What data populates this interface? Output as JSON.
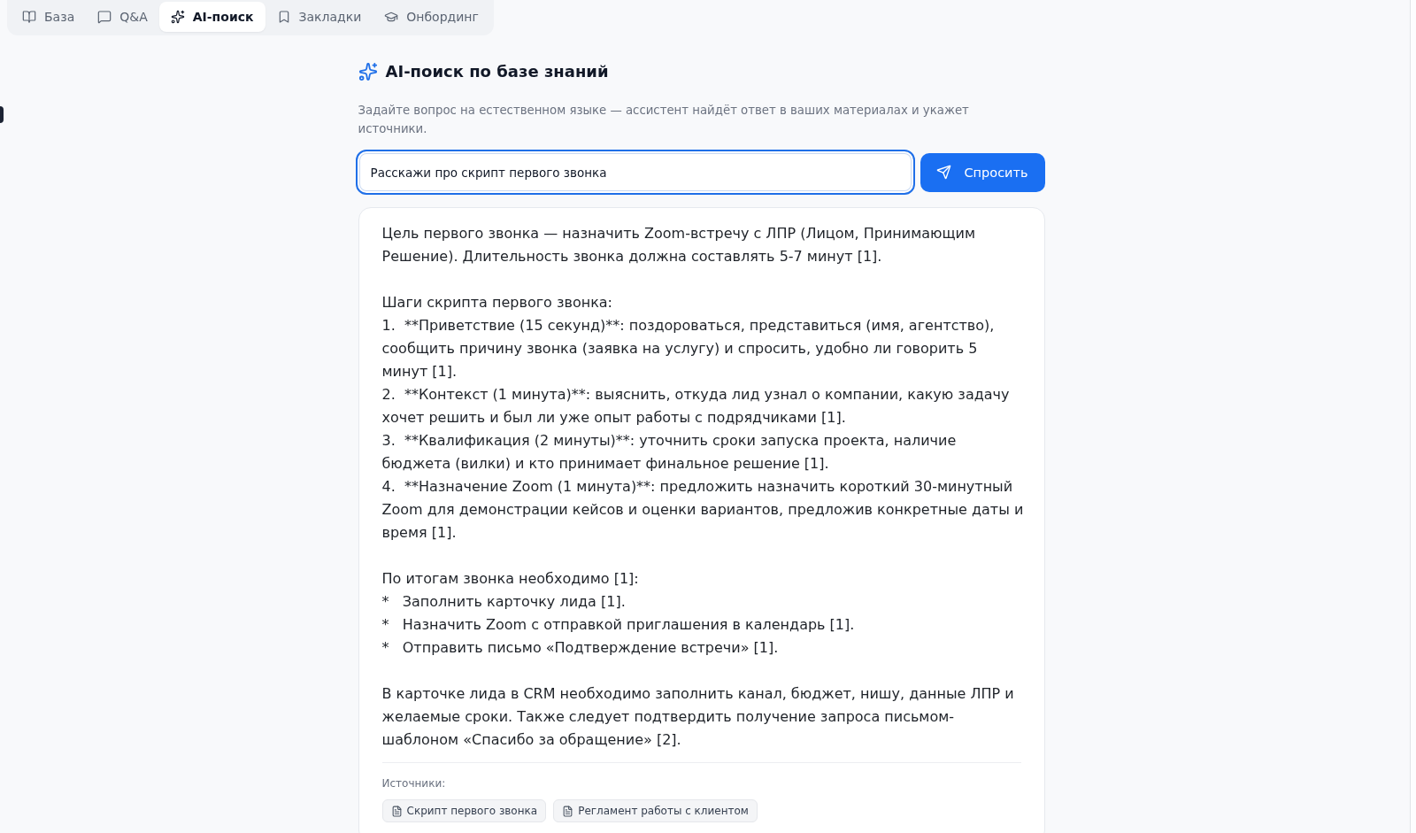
{
  "tabs": [
    {
      "label": "База",
      "selected": false
    },
    {
      "label": "Q&A",
      "selected": false
    },
    {
      "label": "AI-поиск",
      "selected": true
    },
    {
      "label": "Закладки",
      "selected": false
    },
    {
      "label": "Онбординг",
      "selected": false
    }
  ],
  "header": {
    "title": "AI-поиск по базе знаний",
    "subtitle": "Задайте вопрос на естественном языке — ассистент найдёт ответ в ваших материалах и укажет источники."
  },
  "query": {
    "value": "Расскажи про скрипт первого звонка"
  },
  "ask_button": {
    "label": "Спросить"
  },
  "answer": {
    "blocks": [
      {
        "lines": [
          "Цель первого звонка — назначить Zoom-встречу с ЛПР (Лицом, Принимающим Решение). Длительность звонка должна составлять 5-7 минут [1]."
        ]
      },
      {
        "lines": [
          "Шаги скрипта первого звонка:",
          "1.  **Приветствие (15 секунд)**: поздороваться, представиться (имя, агентство), сообщить причину звонка (заявка на услугу) и спросить, удобно ли говорить 5 минут [1].",
          "2.  **Контекст (1 минута)**: выяснить, откуда лид узнал о компании, какую задачу хочет решить и был ли уже опыт работы с подрядчиками [1].",
          "3.  **Квалификация (2 минуты)**: уточнить сроки запуска проекта, наличие бюджета (вилки) и кто принимает финальное решение [1].",
          "4.  **Назначение Zoom (1 минута)**: предложить назначить короткий 30-минутный Zoom для демонстрации кейсов и оценки вариантов, предложив конкретные даты и время [1]."
        ]
      },
      {
        "lines": [
          "По итогам звонка необходимо [1]:",
          "*   Заполнить карточку лида [1].",
          "*   Назначить Zoom с отправкой приглашения в календарь [1].",
          "*   Отправить письмо «Подтверждение встречи» [1]."
        ]
      },
      {
        "lines": [
          "В карточке лида в CRM необходимо заполнить канал, бюджет, нишу, данные ЛПР и желаемые сроки. Также следует подтвердить получение запроса письмом-шаблоном «Спасибо за обращение» [2]."
        ]
      }
    ],
    "sources_label": "Источники:",
    "sources": [
      {
        "title": "Скрипт первого звонка"
      },
      {
        "title": "Регламент работы с клиентом"
      }
    ]
  }
}
